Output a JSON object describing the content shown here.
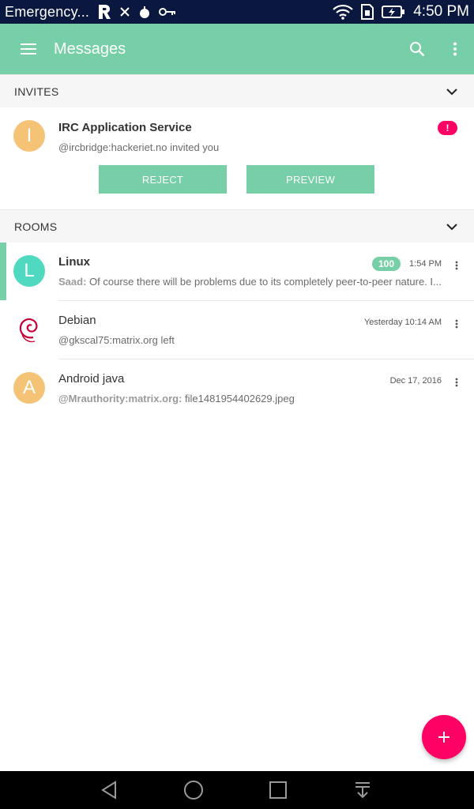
{
  "status_bar": {
    "carrier": "Emergency...",
    "time": "4:50 PM",
    "left_icons": [
      "riot-icon",
      "x-icon",
      "bomb-icon",
      "key-icon"
    ],
    "right_icons": [
      "wifi-icon",
      "sim-icon",
      "battery-charging-icon"
    ]
  },
  "app_bar": {
    "title": "Messages",
    "actions": [
      "search-icon",
      "more-vert-icon"
    ],
    "color": "#76cfa6"
  },
  "invites": {
    "header": "INVITES",
    "items": [
      {
        "avatar_letter": "I",
        "title": "IRC Application Service",
        "subtitle": "@ircbridge:hackeriet.no invited you",
        "alert": "!",
        "reject_label": "REJECT",
        "preview_label": "PREVIEW"
      }
    ]
  },
  "rooms": {
    "header": "ROOMS",
    "items": [
      {
        "avatar_letter": "L",
        "name": "Linux",
        "badge": "100",
        "time": "1:54 PM",
        "sender": "Saad:",
        "message": "Of course there will be problems due to its completely peer-to-peer nature. I..."
      },
      {
        "avatar_icon": "debian-swirl-icon",
        "name": "Debian",
        "time": "Yesterday 10:14 AM",
        "sender": "",
        "message": "@gkscal75:matrix.org left"
      },
      {
        "avatar_letter": "A",
        "name": "Android java",
        "time": "Dec 17, 2016",
        "sender": "@Mrauthority:matrix.org:",
        "message": "file1481954402629.jpeg"
      }
    ]
  },
  "fab": {
    "icon": "plus-icon",
    "color": "#ff0064"
  },
  "nav_bar": {
    "buttons": [
      "back-icon",
      "home-icon",
      "recents-icon",
      "notification-pull-icon"
    ]
  }
}
